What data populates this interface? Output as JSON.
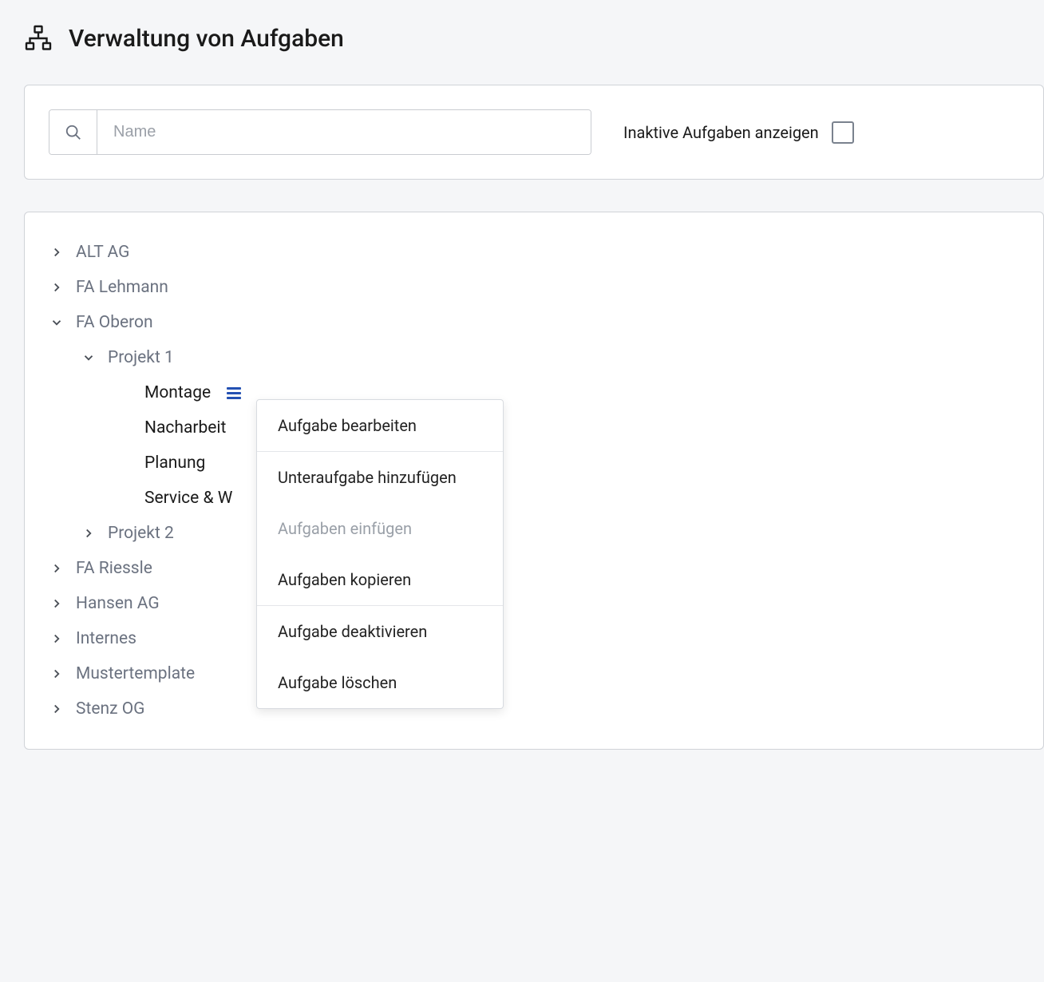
{
  "header": {
    "title": "Verwaltung von Aufgaben"
  },
  "filter": {
    "search_placeholder": "Name",
    "inactive_label": "Inaktive Aufgaben anzeigen"
  },
  "tree": {
    "items": [
      {
        "label": "ALT AG",
        "level": 0,
        "expanded": false,
        "hasChildren": true,
        "active": false
      },
      {
        "label": "FA Lehmann",
        "level": 0,
        "expanded": false,
        "hasChildren": true,
        "active": false
      },
      {
        "label": "FA Oberon",
        "level": 0,
        "expanded": true,
        "hasChildren": true,
        "active": false
      },
      {
        "label": "Projekt 1",
        "level": 1,
        "expanded": true,
        "hasChildren": true,
        "active": false
      },
      {
        "label": "Montage",
        "level": 2,
        "expanded": false,
        "hasChildren": false,
        "active": true,
        "menuOpen": true
      },
      {
        "label": "Nacharbeit",
        "level": 2,
        "expanded": false,
        "hasChildren": false,
        "active": true
      },
      {
        "label": "Planung",
        "level": 2,
        "expanded": false,
        "hasChildren": false,
        "active": true
      },
      {
        "label": "Service & W",
        "level": 2,
        "expanded": false,
        "hasChildren": false,
        "active": true
      },
      {
        "label": "Projekt 2",
        "level": 1,
        "expanded": false,
        "hasChildren": true,
        "active": false
      },
      {
        "label": "FA Riessle",
        "level": 0,
        "expanded": false,
        "hasChildren": true,
        "active": false
      },
      {
        "label": "Hansen AG",
        "level": 0,
        "expanded": false,
        "hasChildren": true,
        "active": false
      },
      {
        "label": "Internes",
        "level": 0,
        "expanded": false,
        "hasChildren": true,
        "active": false
      },
      {
        "label": "Mustertemplate",
        "level": 0,
        "expanded": false,
        "hasChildren": true,
        "active": false
      },
      {
        "label": "Stenz OG",
        "level": 0,
        "expanded": false,
        "hasChildren": true,
        "active": false
      }
    ]
  },
  "context_menu": {
    "groups": [
      [
        {
          "label": "Aufgabe bearbeiten",
          "disabled": false
        }
      ],
      [
        {
          "label": "Unteraufgabe hinzufügen",
          "disabled": false
        },
        {
          "label": "Aufgaben einfügen",
          "disabled": true
        },
        {
          "label": "Aufgaben kopieren",
          "disabled": false
        }
      ],
      [
        {
          "label": "Aufgabe deaktivieren",
          "disabled": false
        },
        {
          "label": "Aufgabe löschen",
          "disabled": false
        }
      ]
    ]
  }
}
